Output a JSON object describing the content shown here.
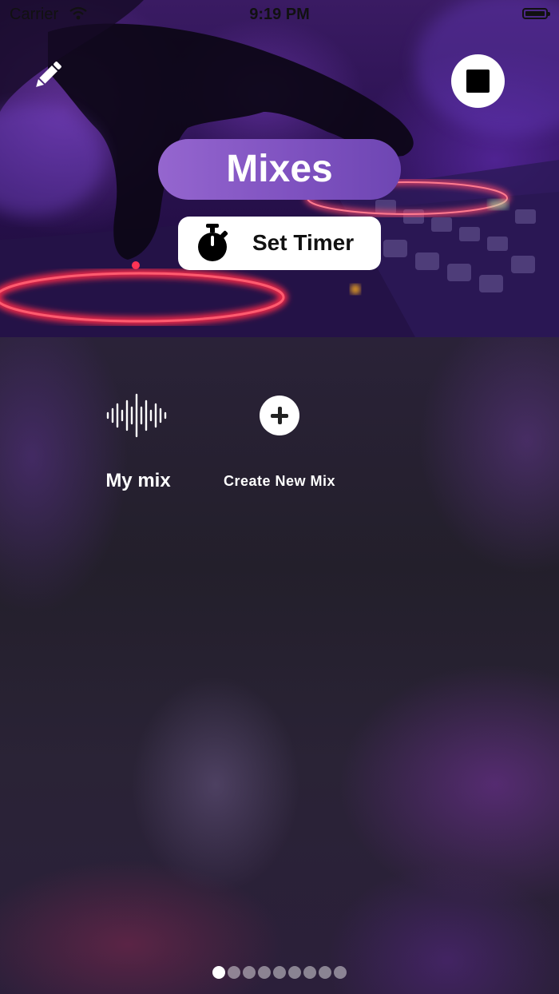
{
  "status_bar": {
    "carrier": "Carrier",
    "time": "9:19 PM"
  },
  "header": {
    "title": "Mixes",
    "timer_label": "Set Timer"
  },
  "icons": {
    "edit": "pencil-icon",
    "stop": "stop-icon",
    "timer": "stopwatch-icon",
    "mix": "sound-wave-icon",
    "add": "plus-circle-icon"
  },
  "mixes": {
    "items": [
      {
        "label": "My mix"
      },
      {
        "label": "Create New Mix"
      }
    ]
  },
  "pager": {
    "count": 9,
    "active_index": 0
  },
  "colors": {
    "accent": "#8a5cc8",
    "background": "#231f2b"
  }
}
